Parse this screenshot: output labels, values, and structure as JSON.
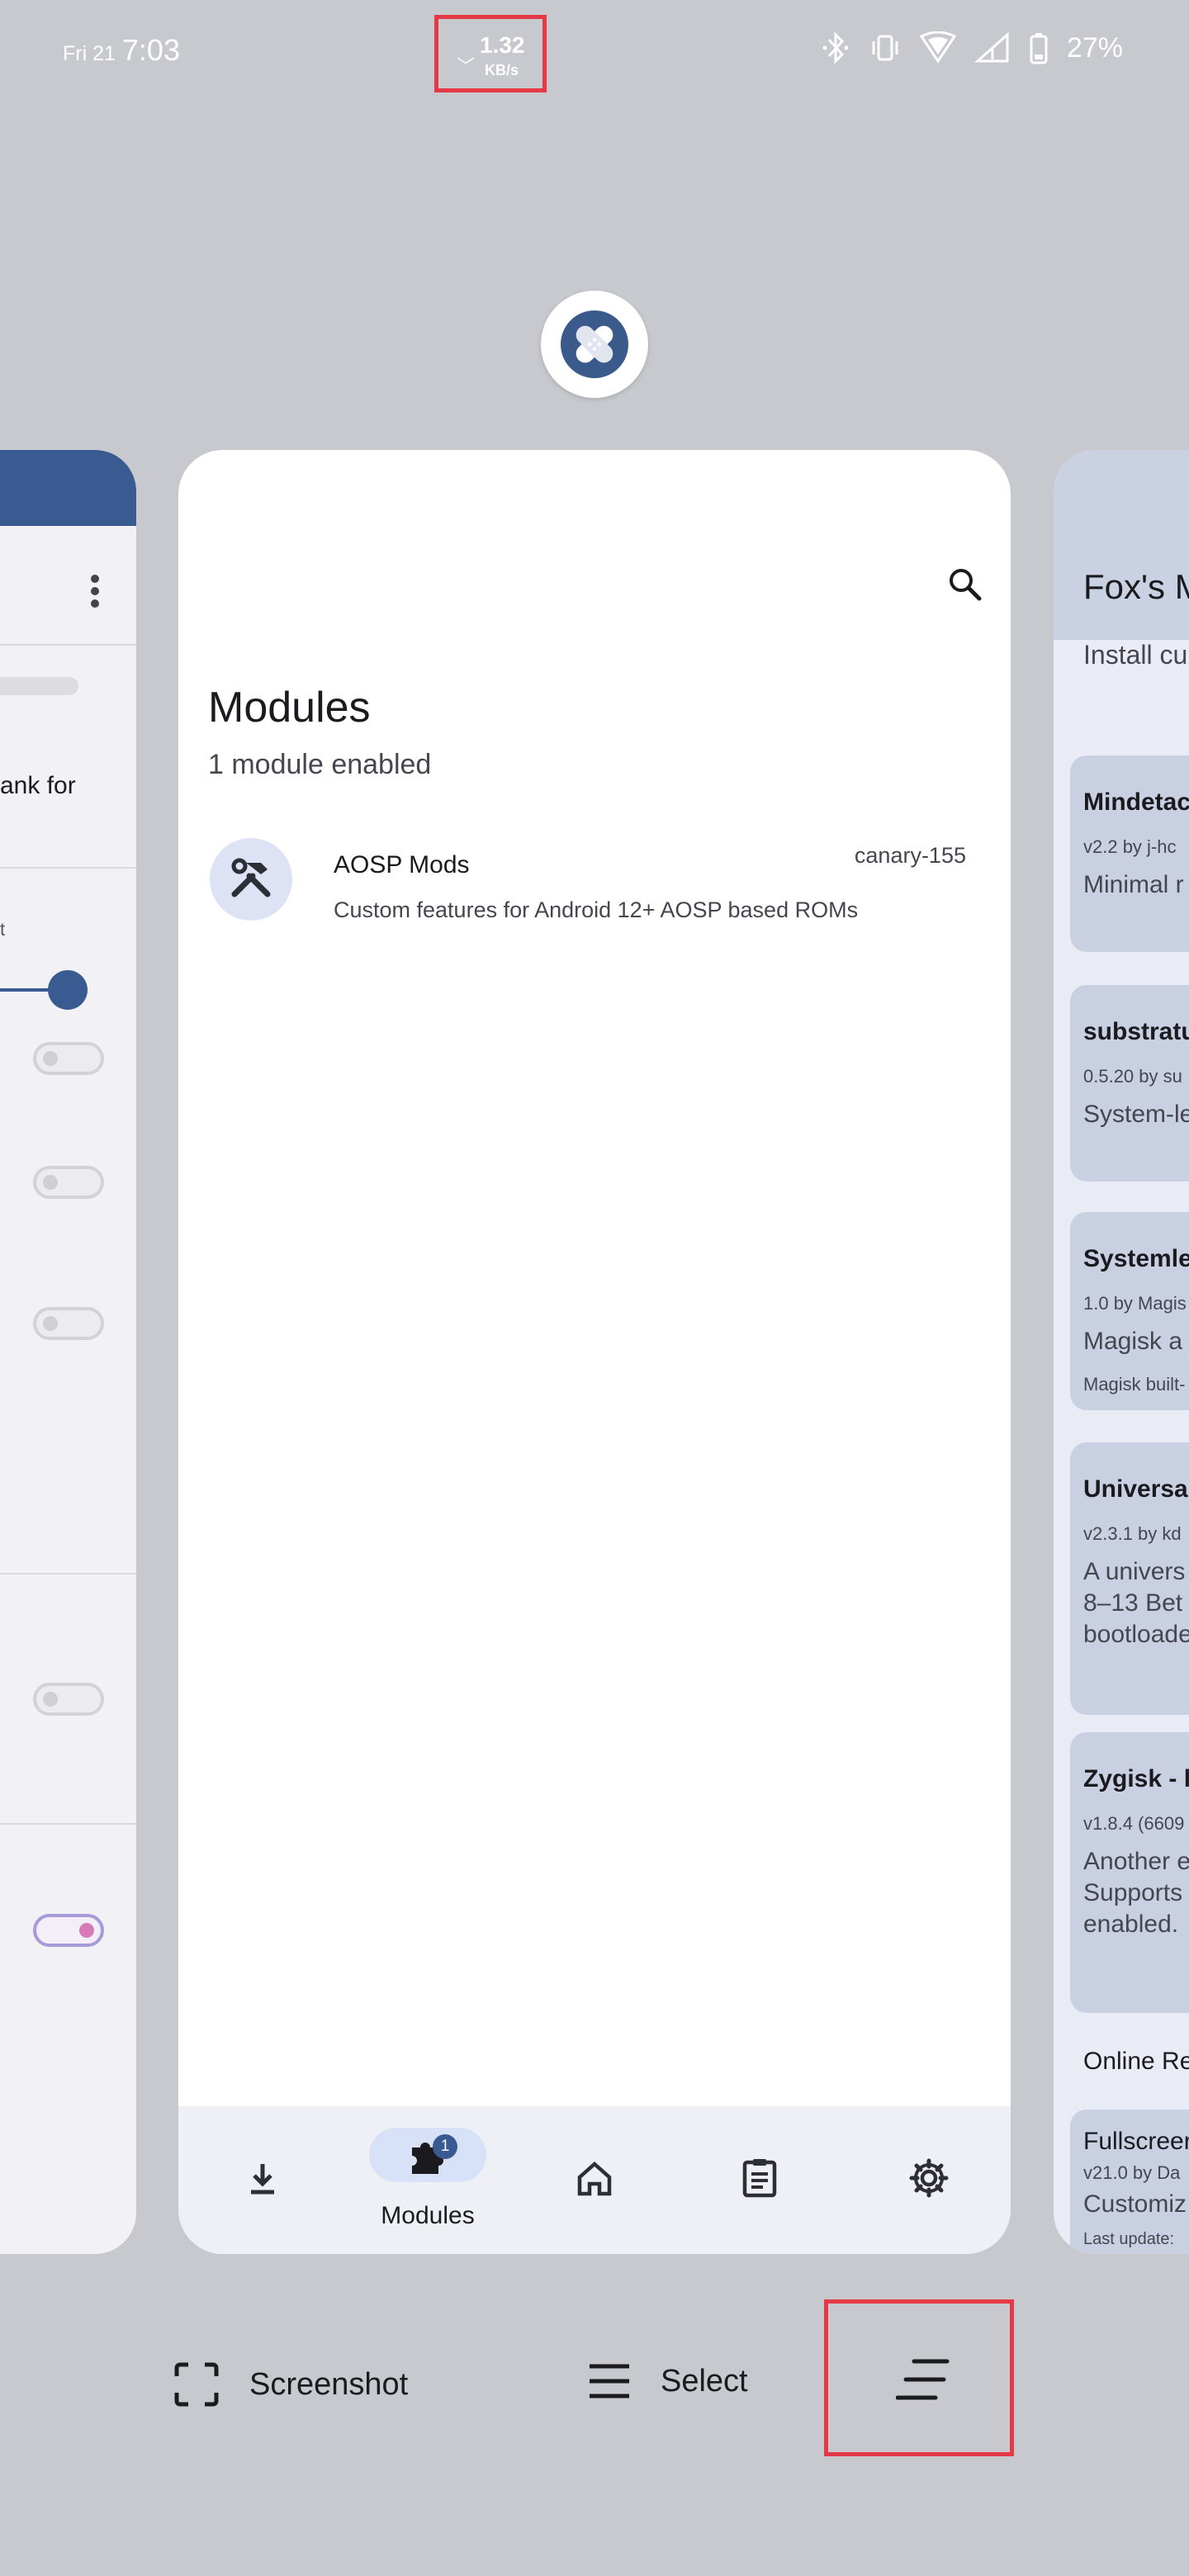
{
  "status_bar": {
    "date": "Fri 21",
    "time": "7:03",
    "net_speed_value": "1.32",
    "net_speed_unit": "KB/s",
    "battery": "27%",
    "icons": [
      "bluetooth-icon",
      "vibrate-icon",
      "wifi-icon",
      "cell-signal-icon",
      "battery-icon"
    ]
  },
  "left_card": {
    "text_fragment": "ank for",
    "small_fragment": "t",
    "toggles": [
      false,
      false,
      false,
      false,
      true
    ],
    "slider_value": 1.0
  },
  "center_card": {
    "title": "Modules",
    "subtitle": "1 module enabled",
    "modules": [
      {
        "name": "AOSP Mods",
        "version": "canary-155",
        "description": "Custom features for Android 12+ AOSP based ROMs"
      }
    ],
    "nav": {
      "active_label": "Modules",
      "badge": "1",
      "items": [
        "download-icon",
        "modules-icon",
        "home-icon",
        "logs-icon",
        "settings-icon"
      ]
    }
  },
  "right_card": {
    "title": "Fox's M",
    "subtitle": "Install cu",
    "cards": [
      {
        "name": "Mindetac",
        "by": "v2.2 by j-hc",
        "desc": "Minimal r",
        "extra": ""
      },
      {
        "name": "substratu",
        "by": "0.5.20 by su",
        "desc": "System-le",
        "extra": ""
      },
      {
        "name": "Systemle",
        "by": "1.0 by Magis",
        "desc": "Magisk a",
        "extra": "Magisk built-"
      },
      {
        "name": "Universal",
        "by": "v2.3.1 by kd",
        "desc": "A univers\n8–13 Bet\nbootloade",
        "extra": ""
      },
      {
        "name": "Zygisk - l",
        "by": "v1.8.4 (6609",
        "desc": "Another e\nSupports\nenabled.",
        "extra": ""
      }
    ],
    "online_label": "Online Re",
    "online_card": {
      "name": "Fullscreer",
      "by": "v21.0 by Da",
      "desc": "Customiz",
      "extra": "Last update:"
    }
  },
  "recents_actions": {
    "screenshot_label": "Screenshot",
    "select_label": "Select"
  }
}
